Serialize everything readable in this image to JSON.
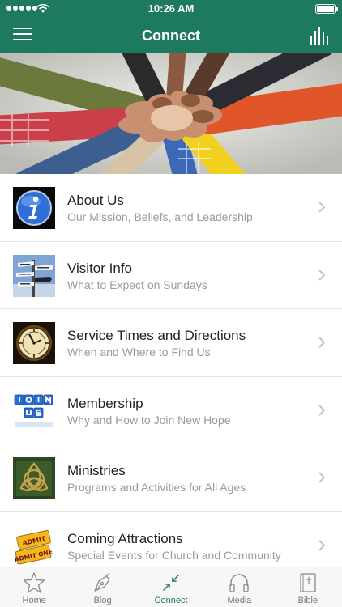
{
  "status_bar": {
    "time": "10:26 AM"
  },
  "nav": {
    "title": "Connect",
    "menu_icon": "hamburger-menu-icon",
    "right_icon": "audio-levels-icon"
  },
  "hero": {
    "alt": "hands-together-photo"
  },
  "items": [
    {
      "title": "About Us",
      "subtitle": "Our Mission, Beliefs, and Leadership",
      "icon": "info-icon"
    },
    {
      "title": "Visitor Info",
      "subtitle": "What to Expect on Sundays",
      "icon": "signpost-icon"
    },
    {
      "title": "Service Times and Directions",
      "subtitle": "When and Where to Find Us",
      "icon": "clock-icon"
    },
    {
      "title": "Membership",
      "subtitle": "Why and How to Join New Hope",
      "icon": "join-us-blocks-icon"
    },
    {
      "title": "Ministries",
      "subtitle": "Programs and Activities for All Ages",
      "icon": "triquetra-icon"
    },
    {
      "title": "Coming Attractions",
      "subtitle": "Special Events for Church and Community",
      "icon": "admit-one-tickets-icon"
    }
  ],
  "tabs": [
    {
      "label": "Home",
      "icon": "star-icon"
    },
    {
      "label": "Blog",
      "icon": "pen-nib-icon"
    },
    {
      "label": "Connect",
      "icon": "connect-arrows-icon"
    },
    {
      "label": "Media",
      "icon": "headphones-icon"
    },
    {
      "label": "Bible",
      "icon": "bible-book-icon"
    }
  ],
  "colors": {
    "brand_green": "#1e7a5e",
    "tab_inactive": "#777777",
    "subtitle_gray": "#9a9a9a"
  }
}
